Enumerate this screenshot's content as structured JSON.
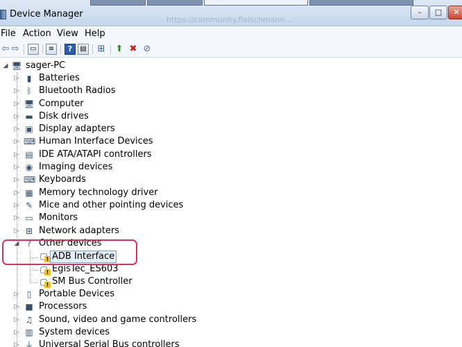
{
  "window": {
    "title": "Device Manager",
    "blurred_url": "https://community.fleischmann...",
    "controls": {
      "minimize": "–",
      "maximize": "□",
      "close": "✕"
    }
  },
  "menu": [
    "File",
    "Action",
    "View",
    "Help"
  ],
  "toolbar_icons": [
    "back-icon",
    "forward-icon",
    "show-hide-console-tree-icon",
    "properties-icon",
    "help-icon",
    "action-pane-icon",
    "scan-hardware-icon",
    "update-driver-icon",
    "uninstall-icon",
    "disable-icon"
  ],
  "tree": {
    "root": "sager-PC",
    "categories": [
      {
        "label": "Batteries",
        "icon": "battery-icon"
      },
      {
        "label": "Bluetooth Radios",
        "icon": "bluetooth-icon"
      },
      {
        "label": "Computer",
        "icon": "computer-icon"
      },
      {
        "label": "Disk drives",
        "icon": "disk-drive-icon"
      },
      {
        "label": "Display adapters",
        "icon": "display-adapter-icon"
      },
      {
        "label": "Human Interface Devices",
        "icon": "hid-icon"
      },
      {
        "label": "IDE ATA/ATAPI controllers",
        "icon": "ide-controller-icon"
      },
      {
        "label": "Imaging devices",
        "icon": "camera-icon"
      },
      {
        "label": "Keyboards",
        "icon": "keyboard-icon"
      },
      {
        "label": "Memory technology driver",
        "icon": "memory-icon"
      },
      {
        "label": "Mice and other pointing devices",
        "icon": "mouse-icon"
      },
      {
        "label": "Monitors",
        "icon": "monitor-icon"
      },
      {
        "label": "Network adapters",
        "icon": "network-icon"
      },
      {
        "label": "Other devices",
        "icon": "unknown-device-icon",
        "expanded": true,
        "children": [
          {
            "label": "ADB Interface",
            "selected": true,
            "warning": true
          },
          {
            "label": "EgisTec_ES603",
            "warning": true
          },
          {
            "label": "SM Bus Controller",
            "warning": true
          }
        ]
      },
      {
        "label": "Portable Devices",
        "icon": "portable-device-icon"
      },
      {
        "label": "Processors",
        "icon": "processor-icon"
      },
      {
        "label": "Sound, video and game controllers",
        "icon": "sound-icon"
      },
      {
        "label": "System devices",
        "icon": "system-device-icon"
      },
      {
        "label": "Universal Serial Bus controllers",
        "icon": "usb-icon"
      }
    ]
  },
  "colors": {
    "annotation": "#d8345f",
    "selection": "#e5effb",
    "warning": "#f2c21b"
  }
}
